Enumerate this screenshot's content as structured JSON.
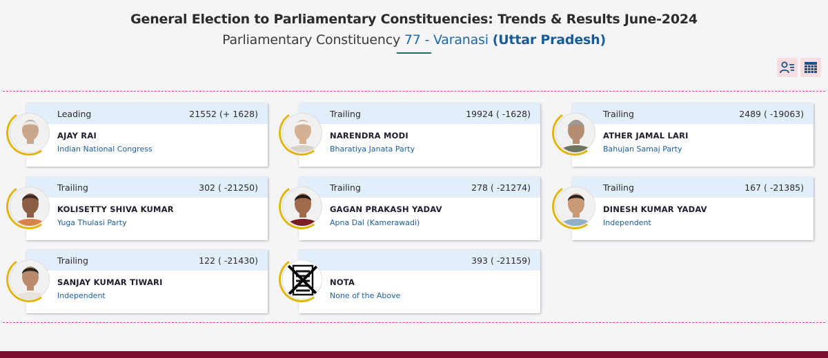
{
  "header": {
    "title": "General Election to Parliamentary Constituencies: Trends & Results June-2024",
    "subtitle_prefix": "Parliamentary Constituency ",
    "constituency_number": "77 - Varanasi",
    "state": "(Uttar Pradesh)"
  },
  "view_toggle": {
    "icons": [
      "user-list-icon",
      "table-grid-icon"
    ]
  },
  "candidates": [
    {
      "status": "Leading",
      "votes": "21552 (+ 1628)",
      "name": "AJAY RAI",
      "party": "Indian National Congress",
      "skin": "#c9a58a",
      "hair": "#e8e8e8",
      "shirt": "#f4f4f4"
    },
    {
      "status": "Trailing",
      "votes": "19924 ( -1628)",
      "name": "NARENDRA MODI",
      "party": "Bharatiya Janata Party",
      "skin": "#d6b092",
      "hair": "#f2f2f2",
      "shirt": "#d8d2c8"
    },
    {
      "status": "Trailing",
      "votes": "2489 ( -19063)",
      "name": "ATHER JAMAL LARI",
      "party": "Bahujan Samaj Party",
      "skin": "#b58d70",
      "hair": "#9a9a9a",
      "shirt": "#6d7560"
    },
    {
      "status": "Trailing",
      "votes": "302 ( -21250)",
      "name": "KOLISETTY SHIVA KUMAR",
      "party": "Yuga Thulasi Party",
      "skin": "#8a5e45",
      "hair": "#3b2b22",
      "shirt": "#d9824a"
    },
    {
      "status": "Trailing",
      "votes": "278 ( -21274)",
      "name": "GAGAN PRAKASH YADAV",
      "party": "Apna Dal (Kamerawadi)",
      "skin": "#a06a4c",
      "hair": "#1f1a18",
      "shirt": "#7a1e22"
    },
    {
      "status": "Trailing",
      "votes": "167 ( -21385)",
      "name": "DINESH KUMAR YADAV",
      "party": "Independent",
      "skin": "#c99a7a",
      "hair": "#2a2220",
      "shirt": "#8fb0c8"
    },
    {
      "status": "Trailing",
      "votes": "122 ( -21430)",
      "name": "SANJAY KUMAR TIWARI",
      "party": "Independent",
      "skin": "#b98a6c",
      "hair": "#2b2522",
      "shirt": "#e8e3db"
    },
    {
      "status": "",
      "votes": "393 ( -21159)",
      "name": "NOTA",
      "party": "None of the Above",
      "skin": "",
      "hair": "",
      "shirt": "",
      "nota": true
    }
  ],
  "colors": {
    "accent_blue": "#1a5fa3",
    "card_header": "#e3eefb",
    "divider": "#d63a9a",
    "ring": "#e2b50e",
    "footer": "#7c1030"
  }
}
